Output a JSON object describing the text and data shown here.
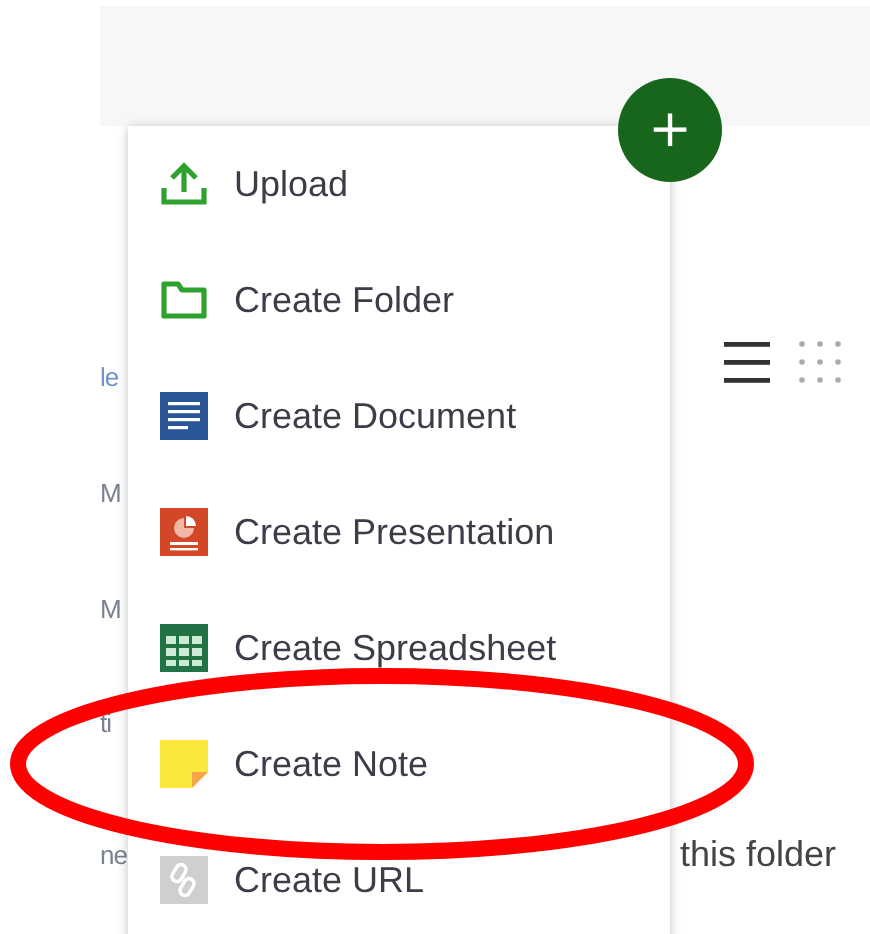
{
  "background": {
    "left_column": [
      "le",
      "M",
      "M",
      "ti",
      "ne"
    ],
    "notice": "this folder"
  },
  "add_button": {
    "label": "+"
  },
  "menu": {
    "items": [
      {
        "kind": "upload",
        "label": "Upload"
      },
      {
        "kind": "folder",
        "label": "Create Folder"
      },
      {
        "kind": "document",
        "label": "Create Document"
      },
      {
        "kind": "presentation",
        "label": "Create Presentation"
      },
      {
        "kind": "spreadsheet",
        "label": "Create Spreadsheet"
      },
      {
        "kind": "note",
        "label": "Create Note"
      },
      {
        "kind": "url",
        "label": "Create URL"
      }
    ]
  }
}
